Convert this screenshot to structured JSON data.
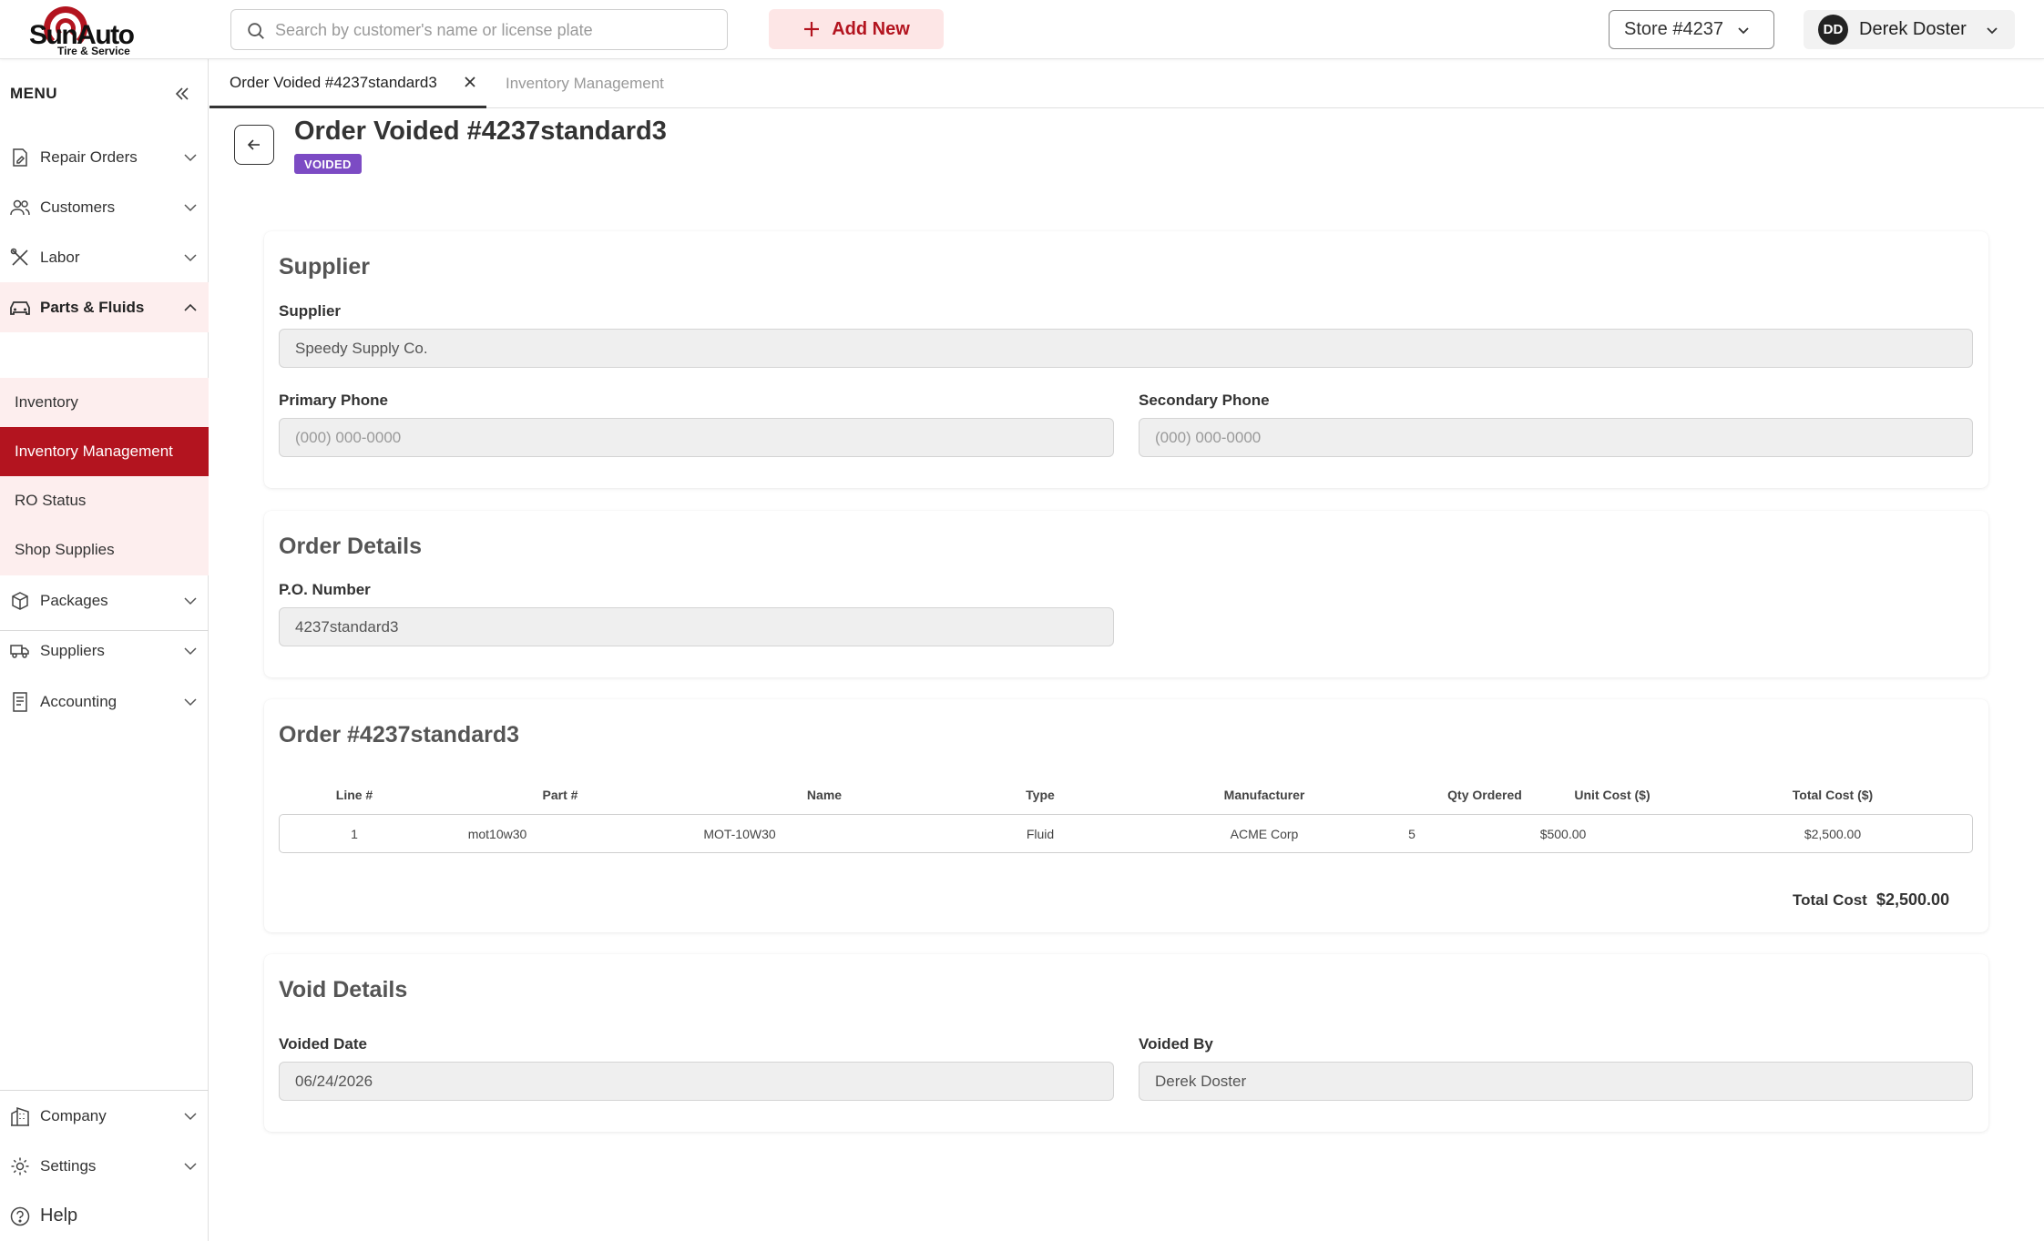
{
  "app": {
    "logo_name": "SunAuto",
    "logo_sub": "Tire & Service"
  },
  "header": {
    "search_placeholder": "Search by customer's name or license plate",
    "add_new_label": "Add New",
    "store_label": "Store #4237",
    "user_initials": "DD",
    "user_name": "Derek Doster"
  },
  "sidebar": {
    "menu_label": "MENU",
    "items": [
      {
        "label": "Repair Orders",
        "icon": "document-edit-icon"
      },
      {
        "label": "Customers",
        "icon": "users-icon"
      },
      {
        "label": "Labor",
        "icon": "tools-icon"
      },
      {
        "label": "Parts & Fluids",
        "icon": "car-icon"
      },
      {
        "label": "Packages",
        "icon": "box-icon"
      },
      {
        "label": "Suppliers",
        "icon": "truck-icon"
      },
      {
        "label": "Accounting",
        "icon": "receipt-icon"
      }
    ],
    "sub_items": [
      "Inventory",
      "Inventory Management",
      "RO Status",
      "Shop Supplies"
    ],
    "bottom_items": [
      {
        "label": "Company",
        "icon": "building-icon"
      },
      {
        "label": "Settings",
        "icon": "gear-icon"
      }
    ],
    "help_label": "Help"
  },
  "tabs": [
    {
      "label": "Order Voided #4237standard3",
      "active": true
    },
    {
      "label": "Inventory Management",
      "active": false
    }
  ],
  "page": {
    "title": "Order Voided #4237standard3",
    "status_badge": "VOIDED",
    "status_color": "#7c4bc4"
  },
  "supplier_section": {
    "heading": "Supplier",
    "supplier_label": "Supplier",
    "supplier_value": "Speedy Supply Co.",
    "primary_phone_label": "Primary Phone",
    "primary_phone_placeholder": "(000) 000-0000",
    "secondary_phone_label": "Secondary Phone",
    "secondary_phone_placeholder": "(000) 000-0000"
  },
  "order_details": {
    "heading": "Order Details",
    "po_label": "P.O. Number",
    "po_value": "4237standard3"
  },
  "order_table": {
    "heading": "Order #4237standard3",
    "columns": [
      "Line #",
      "Part #",
      "Name",
      "Type",
      "Manufacturer",
      "Qty Ordered",
      "Unit Cost ($)",
      "Total Cost ($)"
    ],
    "rows": [
      {
        "line": "1",
        "part": "mot10w30",
        "name": "MOT-10W30",
        "type": "Fluid",
        "manufacturer": "ACME Corp",
        "qty": "5",
        "unit_cost": "$500.00",
        "total_cost": "$2,500.00"
      }
    ],
    "total_label": "Total Cost",
    "total_value": "$2,500.00"
  },
  "void_details": {
    "heading": "Void Details",
    "date_label": "Voided Date",
    "date_value": "06/24/2026",
    "by_label": "Voided By",
    "by_value": "Derek Doster"
  },
  "colors": {
    "brand": "#b3141f",
    "active_nav_bg": "#fdeeee",
    "badge": "#7c4bc4"
  }
}
